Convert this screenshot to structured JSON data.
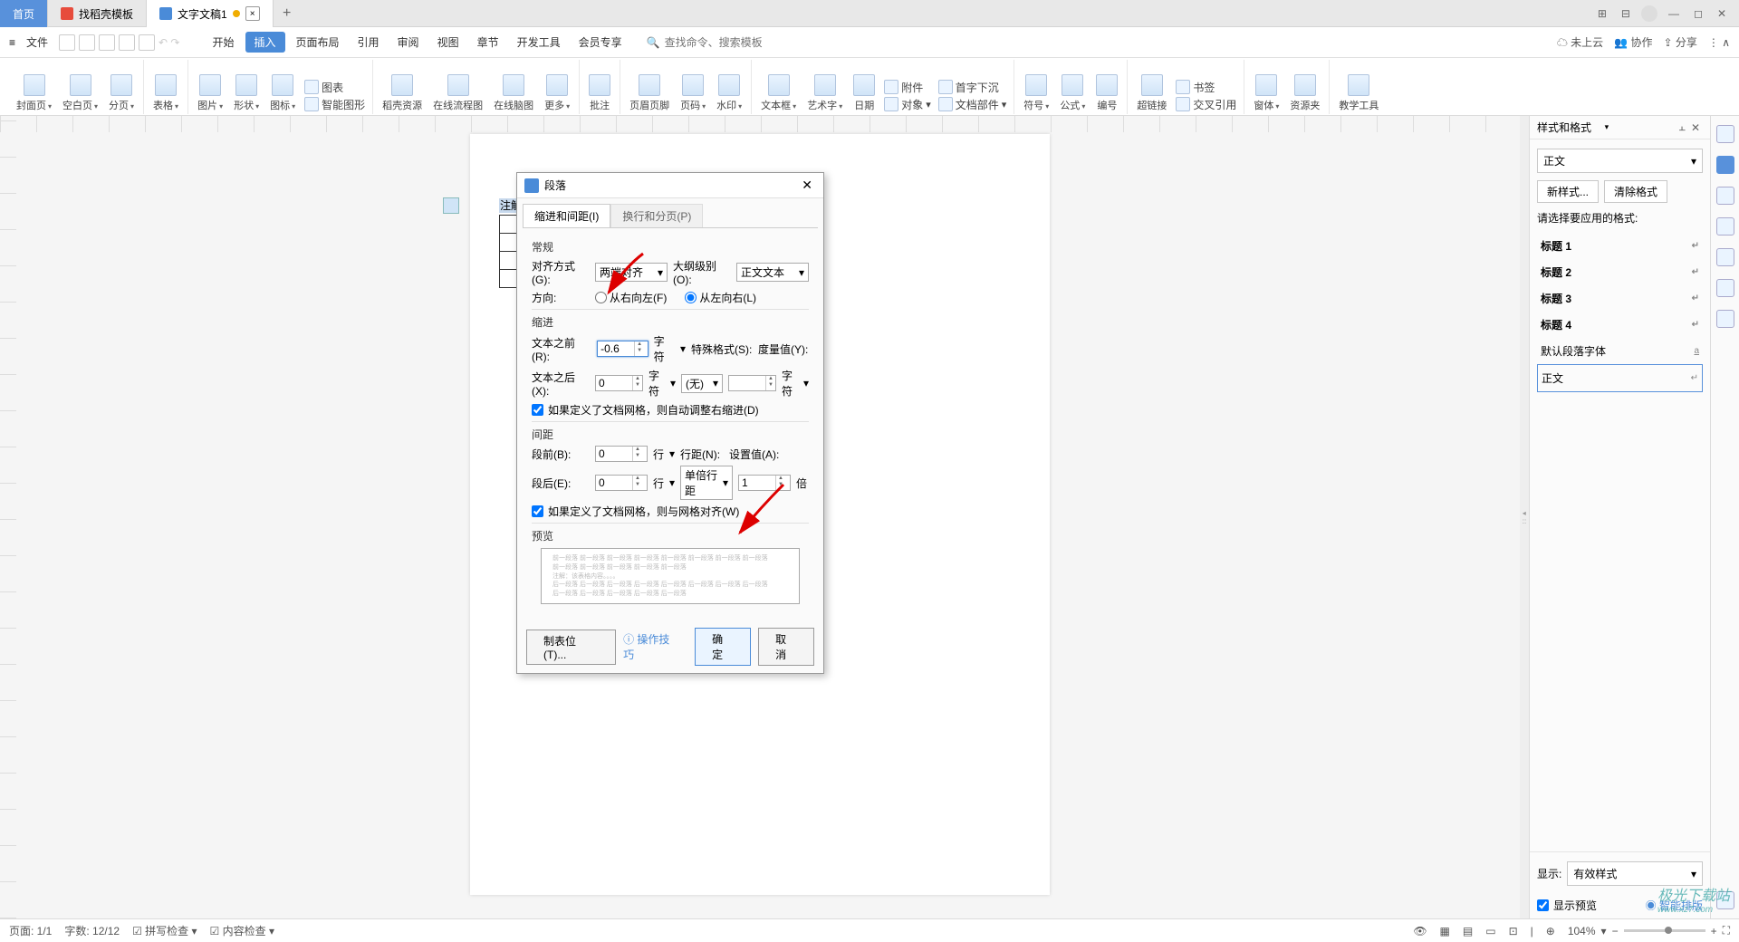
{
  "tabs": {
    "home": "首页",
    "tpl": "找稻壳模板",
    "doc": "文字文稿1"
  },
  "menu": {
    "file": "文件",
    "start": "开始",
    "insert": "插入",
    "layout": "页面布局",
    "ref": "引用",
    "review": "审阅",
    "view": "视图",
    "chapter": "章节",
    "dev": "开发工具",
    "vip": "会员专享",
    "searchPlaceholder": "查找命令、搜索模板",
    "cloud": "未上云",
    "collab": "协作",
    "share": "分享"
  },
  "ribbon": {
    "cover": "封面页",
    "blank": "空白页",
    "break": "分页",
    "table": "表格",
    "pic": "图片",
    "shape": "形状",
    "icon": "图标",
    "chart": "图表",
    "smart": "智能图形",
    "res": "稻壳资源",
    "flow": "在线流程图",
    "mind": "在线脑图",
    "more": "更多",
    "comment": "批注",
    "headerfooter": "页眉页脚",
    "pagenum": "页码",
    "watermark": "水印",
    "textbox": "文本框",
    "wordart": "艺术字",
    "date": "日期",
    "attach": "附件",
    "object": "对象",
    "parts": "文档部件",
    "dropcap": "首字下沉",
    "symbol": "符号",
    "formula": "公式",
    "number": "编号",
    "link": "超链接",
    "bookmark": "书签",
    "crossref": "交叉引用",
    "window": "窗体",
    "resource": "资源夹",
    "teach": "教学工具"
  },
  "doc": {
    "note": "注解：该表格内容。。。。"
  },
  "dialog": {
    "title": "段落",
    "tab1": "缩进和间距(I)",
    "tab2": "换行和分页(P)",
    "general": "常规",
    "align": "对齐方式(G):",
    "alignVal": "两端对齐",
    "outline": "大纲级别(O):",
    "outlineVal": "正文文本",
    "direction": "方向:",
    "rtl": "从右向左(F)",
    "ltr": "从左向右(L)",
    "indent": "缩进",
    "beforeText": "文本之前(R):",
    "beforeVal": "-0.6",
    "afterText": "文本之后(X):",
    "afterVal": "0",
    "charUnit": "字符",
    "special": "特殊格式(S):",
    "specialVal": "(无)",
    "measure": "度量值(Y):",
    "autoIndent": "如果定义了文档网格，则自动调整右缩进(D)",
    "spacing": "间距",
    "beforePara": "段前(B):",
    "beforeParaVal": "0",
    "afterPara": "段后(E):",
    "afterParaVal": "0",
    "lineUnit": "行",
    "lineSpacing": "行距(N):",
    "lineSpacingVal": "单倍行距",
    "setVal": "设置值(A):",
    "setValNum": "1",
    "times": "倍",
    "snapGrid": "如果定义了文档网格，则与网格对齐(W)",
    "preview": "预览",
    "previewText": "前一段落 前一段落 前一段落 前一段落 前一段落 前一段落 前一段落 前一段落\n前一段落 前一段落 前一段落 前一段落 前一段落\n注解：该表格内容。。。。\n后一段落 后一段落 后一段落 后一段落 后一段落 后一段落 后一段落 后一段落\n后一段落 后一段落 后一段落 后一段落 后一段落",
    "tabstop": "制表位(T)...",
    "tips": "操作技巧",
    "ok": "确定",
    "cancel": "取消"
  },
  "panel": {
    "title": "样式和格式",
    "current": "正文",
    "newStyle": "新样式...",
    "clear": "清除格式",
    "applyPrompt": "请选择要应用的格式:",
    "h1": "标题 1",
    "h2": "标题 2",
    "h3": "标题 3",
    "h4": "标题 4",
    "defaultFont": "默认段落字体",
    "body": "正文",
    "show": "显示:",
    "showVal": "有效样式",
    "showPreview": "显示预览",
    "smartLayout": "智能排版"
  },
  "status": {
    "page": "页面: 1/1",
    "words": "字数: 12/12",
    "spell": "拼写检查",
    "content": "内容检查",
    "zoom": "104%"
  }
}
